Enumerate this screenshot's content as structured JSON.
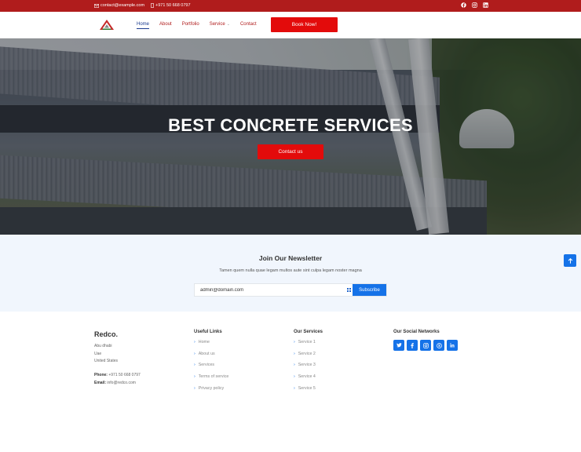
{
  "topbar": {
    "email": "contact@example.com",
    "phone": "+971 50 668 0797",
    "socials": [
      "facebook-icon",
      "instagram-icon",
      "linkedin-icon"
    ]
  },
  "nav": {
    "items": [
      {
        "label": "Home"
      },
      {
        "label": "About"
      },
      {
        "label": "Portfolio"
      },
      {
        "label": "Service"
      },
      {
        "label": "Contact"
      }
    ],
    "book_label": "Book Now!"
  },
  "hero": {
    "title": "BEST CONCRETE SERVICES",
    "button": "Contact us"
  },
  "newsletter": {
    "title": "Join Our Newsletter",
    "text": "Tamen quem nulla quae legam multos aute sint culpa legam noster magna",
    "input_value": "admin@domain.com",
    "button": "Subscribe"
  },
  "footer": {
    "brand": "Redco.",
    "address": [
      "Abu dhabi",
      "Uae",
      "United States"
    ],
    "phone_label": "Phone:",
    "phone": "+971 50 668 0797",
    "email_label": "Email:",
    "email": "info@redco.com",
    "useful_links": {
      "title": "Useful Links",
      "items": [
        "Home",
        "About us",
        "Services",
        "Terms of service",
        "Privacy policy"
      ]
    },
    "our_services": {
      "title": "Our Services",
      "items": [
        "Service 1",
        "Service 2",
        "Service 3",
        "Service 4",
        "Service 5"
      ]
    },
    "social_networks": {
      "title": "Our Social Networks",
      "items": [
        "twitter-icon",
        "facebook-icon",
        "instagram-icon",
        "skype-icon",
        "linkedin-icon"
      ]
    }
  },
  "colors": {
    "brand_red": "#b01c1c",
    "button_red": "#e30b0b",
    "accent_blue": "#1572e8",
    "nav_active": "#1a3a8f"
  }
}
